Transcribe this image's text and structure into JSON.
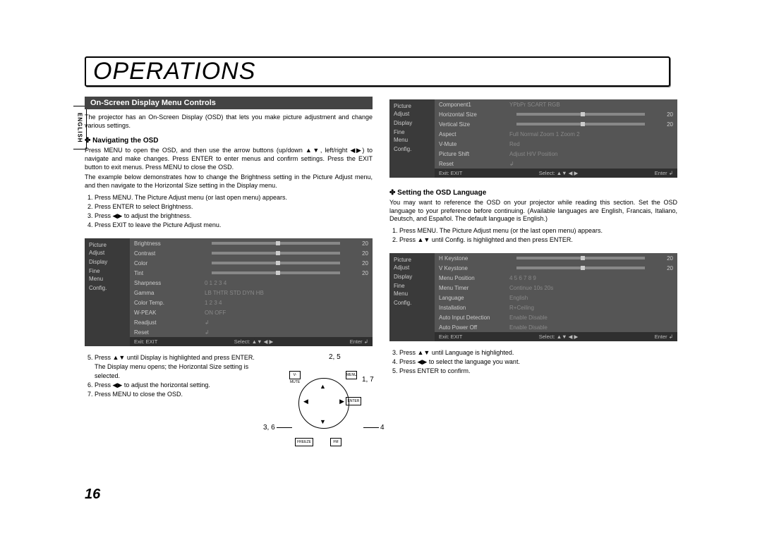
{
  "language_tab": "ENGLISH",
  "page_title": "OPERATIONS",
  "page_number": "16",
  "section_heading": "On-Screen Display Menu Controls",
  "intro": "The projector has an On-Screen Display (OSD) that lets you make picture adjustment and change various settings.",
  "nav_heading": "Navigating the OSD",
  "nav_para1": "Press MENU to open the OSD, and then use the arrow buttons (up/down ▲▼, left/right ◀▶) to navigate and make changes. Press ENTER to enter menus and confirm settings. Press the EXIT button to exit menus. Press MENU to close the OSD.",
  "nav_para2": "The example below demonstrates how to change the Brightness setting in the Picture Adjust menu, and then navigate to the Horizontal Size setting in the Display menu.",
  "steps_a": {
    "s1": "Press MENU. The Picture Adjust menu (or last open menu) appears.",
    "s2": "Press ENTER to select Brightness.",
    "s3": "Press ◀▶ to adjust the brightness.",
    "s4": "Press EXIT to leave the Picture Adjust menu."
  },
  "steps_b": {
    "s5": "Press ▲▼ until Display is highlighted and press ENTER. The Display menu opens; the Horizontal Size setting is selected.",
    "s6": "Press ◀▶ to adjust the horizontal setting.",
    "s7": "Press MENU to close the OSD."
  },
  "lang_heading": "Setting the OSD Language",
  "lang_para": "You may want to reference the OSD on your projector while reading this section. Set the OSD language to your preference before continuing. (Available languages are English, Francais, Italiano, Deutsch, and Español. The default language is English.)",
  "lang_steps_a": {
    "s1": "Press MENU. The Picture Adjust menu (or the last open menu) appears.",
    "s2": "Press ▲▼ until Config. is highlighted and then press ENTER."
  },
  "lang_steps_b": {
    "s3": "Press ▲▼ until Language is highlighted.",
    "s4": "Press ◀▶ to select the language you want.",
    "s5": "Press ENTER to confirm."
  },
  "osd_sidebar": [
    "Picture",
    "Adjust",
    "",
    "Display",
    "",
    "Fine",
    "Menu",
    "",
    "Config."
  ],
  "osd1": {
    "rows": [
      {
        "lab": "Brightness",
        "mid": "",
        "val": "20",
        "slider": true
      },
      {
        "lab": "Contrast",
        "mid": "",
        "val": "20",
        "slider": true
      },
      {
        "lab": "Color",
        "mid": "",
        "val": "20",
        "slider": true
      },
      {
        "lab": "Tint",
        "mid": "",
        "val": "20",
        "slider": true
      },
      {
        "lab": "Sharpness",
        "mid": "0   1   2   3   4",
        "val": ""
      },
      {
        "lab": "Gamma",
        "mid": "LB  THTR  STD  DYN  HB",
        "val": ""
      },
      {
        "lab": "Color Temp.",
        "mid": "1   2   3   4",
        "val": ""
      },
      {
        "lab": "W-PEAK",
        "mid": "ON       OFF",
        "val": ""
      },
      {
        "lab": "Readjust",
        "mid": "↲",
        "val": ""
      },
      {
        "lab": "Reset",
        "mid": "↲",
        "val": ""
      }
    ]
  },
  "osd2": {
    "rows": [
      {
        "lab": "Component1",
        "mid": "YPbPr   SCART   RGB",
        "val": ""
      },
      {
        "lab": "Horizontal Size",
        "mid": "",
        "val": "20",
        "slider": true
      },
      {
        "lab": "Vertical Size",
        "mid": "",
        "val": "20",
        "slider": true
      },
      {
        "lab": "Aspect",
        "mid": "Full   Normal   Zoom 1   Zoom 2",
        "val": ""
      },
      {
        "lab": "V-Mute",
        "mid": "Red",
        "val": ""
      },
      {
        "lab": "Picture Shift",
        "mid": "Adjust H/V Position",
        "val": ""
      },
      {
        "lab": "Reset",
        "mid": "↲",
        "val": ""
      }
    ]
  },
  "osd3": {
    "rows": [
      {
        "lab": "H Keystone",
        "mid": "",
        "val": "20",
        "slider": true
      },
      {
        "lab": "V Keystone",
        "mid": "",
        "val": "20",
        "slider": true
      },
      {
        "lab": "Menu Position",
        "mid": "4  5  6  7  8  9",
        "val": ""
      },
      {
        "lab": "Menu Timer",
        "mid": "Continue      10s     20s",
        "val": ""
      },
      {
        "lab": "Language",
        "mid": "English",
        "val": ""
      },
      {
        "lab": "Installation",
        "mid": "R+Ceiling",
        "val": ""
      },
      {
        "lab": "Auto Input Detection",
        "mid": "Enable      Disable",
        "val": ""
      },
      {
        "lab": "Auto Power Off",
        "mid": "Enable      Disable",
        "val": ""
      }
    ]
  },
  "osd_footer": {
    "exit": "Exit: EXIT",
    "select": "Select: ▲▼ ◀ ▶",
    "enter": "Enter   ↲"
  },
  "callouts": {
    "c25": "2, 5",
    "c17": "1, 7",
    "c36": "3, 6",
    "c4": "4"
  },
  "remote_labels": {
    "vmute": "V-MUTE",
    "menu": "MENU",
    "enter": "ENTER",
    "freeze": "FREEZE",
    "fm": "FM"
  }
}
